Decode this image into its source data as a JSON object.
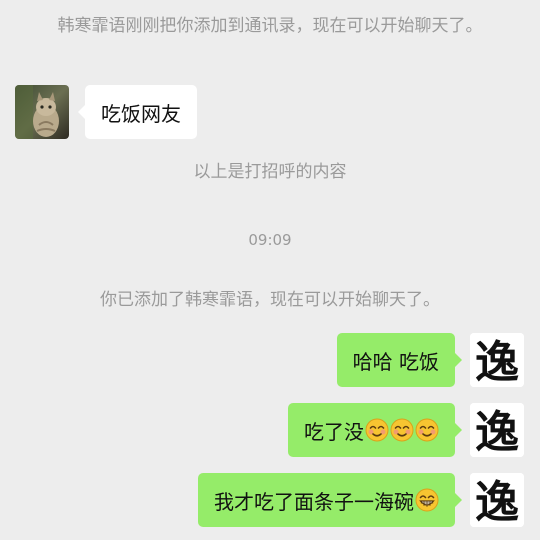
{
  "system_messages": {
    "added_to_contacts": "韩寒霏语刚刚把你添加到通讯录，现在可以开始聊天了。",
    "greeting_note": "以上是打招呼的内容",
    "you_added": "你已添加了韩寒霏语，现在可以开始聊天了。"
  },
  "timestamp": "09:09",
  "messages": [
    {
      "side": "left",
      "text": "吃饭网友",
      "avatar": "cat-avatar"
    },
    {
      "side": "right",
      "text": "哈哈 吃饭",
      "avatar": "calligraphy-avatar"
    },
    {
      "side": "right",
      "text": "吃了没",
      "emoji": [
        "blush-smile-emoji",
        "blush-smile-emoji",
        "blush-smile-emoji"
      ],
      "avatar": "calligraphy-avatar"
    },
    {
      "side": "right",
      "text": "我才吃了面条子一海碗",
      "emoji": [
        "grin-emoji"
      ],
      "avatar": "calligraphy-avatar"
    }
  ],
  "avatar_right_glyph": "逸",
  "colors": {
    "background": "#ededed",
    "outgoing_bubble": "#95ec69",
    "incoming_bubble": "#ffffff",
    "system_text": "#9a9a9a"
  }
}
